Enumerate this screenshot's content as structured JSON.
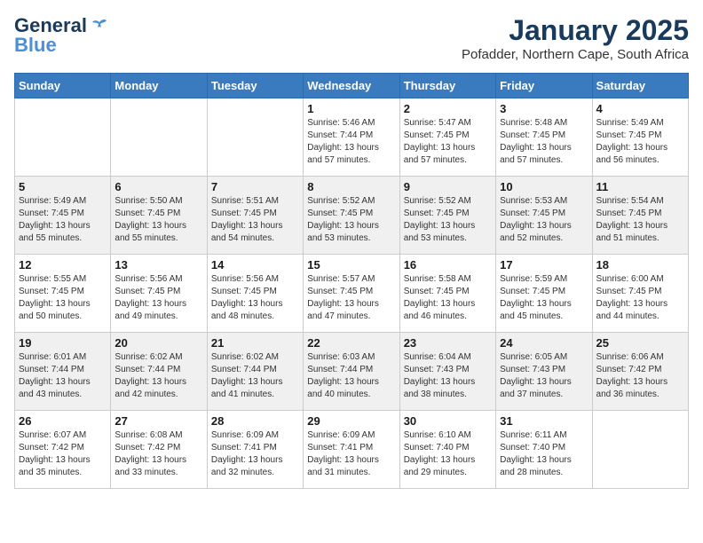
{
  "header": {
    "logo_line1": "General",
    "logo_line2": "Blue",
    "month": "January 2025",
    "location": "Pofadder, Northern Cape, South Africa"
  },
  "weekdays": [
    "Sunday",
    "Monday",
    "Tuesday",
    "Wednesday",
    "Thursday",
    "Friday",
    "Saturday"
  ],
  "weeks": [
    [
      {
        "day": "",
        "info": ""
      },
      {
        "day": "",
        "info": ""
      },
      {
        "day": "",
        "info": ""
      },
      {
        "day": "1",
        "info": "Sunrise: 5:46 AM\nSunset: 7:44 PM\nDaylight: 13 hours\nand 57 minutes."
      },
      {
        "day": "2",
        "info": "Sunrise: 5:47 AM\nSunset: 7:45 PM\nDaylight: 13 hours\nand 57 minutes."
      },
      {
        "day": "3",
        "info": "Sunrise: 5:48 AM\nSunset: 7:45 PM\nDaylight: 13 hours\nand 57 minutes."
      },
      {
        "day": "4",
        "info": "Sunrise: 5:49 AM\nSunset: 7:45 PM\nDaylight: 13 hours\nand 56 minutes."
      }
    ],
    [
      {
        "day": "5",
        "info": "Sunrise: 5:49 AM\nSunset: 7:45 PM\nDaylight: 13 hours\nand 55 minutes."
      },
      {
        "day": "6",
        "info": "Sunrise: 5:50 AM\nSunset: 7:45 PM\nDaylight: 13 hours\nand 55 minutes."
      },
      {
        "day": "7",
        "info": "Sunrise: 5:51 AM\nSunset: 7:45 PM\nDaylight: 13 hours\nand 54 minutes."
      },
      {
        "day": "8",
        "info": "Sunrise: 5:52 AM\nSunset: 7:45 PM\nDaylight: 13 hours\nand 53 minutes."
      },
      {
        "day": "9",
        "info": "Sunrise: 5:52 AM\nSunset: 7:45 PM\nDaylight: 13 hours\nand 53 minutes."
      },
      {
        "day": "10",
        "info": "Sunrise: 5:53 AM\nSunset: 7:45 PM\nDaylight: 13 hours\nand 52 minutes."
      },
      {
        "day": "11",
        "info": "Sunrise: 5:54 AM\nSunset: 7:45 PM\nDaylight: 13 hours\nand 51 minutes."
      }
    ],
    [
      {
        "day": "12",
        "info": "Sunrise: 5:55 AM\nSunset: 7:45 PM\nDaylight: 13 hours\nand 50 minutes."
      },
      {
        "day": "13",
        "info": "Sunrise: 5:56 AM\nSunset: 7:45 PM\nDaylight: 13 hours\nand 49 minutes."
      },
      {
        "day": "14",
        "info": "Sunrise: 5:56 AM\nSunset: 7:45 PM\nDaylight: 13 hours\nand 48 minutes."
      },
      {
        "day": "15",
        "info": "Sunrise: 5:57 AM\nSunset: 7:45 PM\nDaylight: 13 hours\nand 47 minutes."
      },
      {
        "day": "16",
        "info": "Sunrise: 5:58 AM\nSunset: 7:45 PM\nDaylight: 13 hours\nand 46 minutes."
      },
      {
        "day": "17",
        "info": "Sunrise: 5:59 AM\nSunset: 7:45 PM\nDaylight: 13 hours\nand 45 minutes."
      },
      {
        "day": "18",
        "info": "Sunrise: 6:00 AM\nSunset: 7:45 PM\nDaylight: 13 hours\nand 44 minutes."
      }
    ],
    [
      {
        "day": "19",
        "info": "Sunrise: 6:01 AM\nSunset: 7:44 PM\nDaylight: 13 hours\nand 43 minutes."
      },
      {
        "day": "20",
        "info": "Sunrise: 6:02 AM\nSunset: 7:44 PM\nDaylight: 13 hours\nand 42 minutes."
      },
      {
        "day": "21",
        "info": "Sunrise: 6:02 AM\nSunset: 7:44 PM\nDaylight: 13 hours\nand 41 minutes."
      },
      {
        "day": "22",
        "info": "Sunrise: 6:03 AM\nSunset: 7:44 PM\nDaylight: 13 hours\nand 40 minutes."
      },
      {
        "day": "23",
        "info": "Sunrise: 6:04 AM\nSunset: 7:43 PM\nDaylight: 13 hours\nand 38 minutes."
      },
      {
        "day": "24",
        "info": "Sunrise: 6:05 AM\nSunset: 7:43 PM\nDaylight: 13 hours\nand 37 minutes."
      },
      {
        "day": "25",
        "info": "Sunrise: 6:06 AM\nSunset: 7:42 PM\nDaylight: 13 hours\nand 36 minutes."
      }
    ],
    [
      {
        "day": "26",
        "info": "Sunrise: 6:07 AM\nSunset: 7:42 PM\nDaylight: 13 hours\nand 35 minutes."
      },
      {
        "day": "27",
        "info": "Sunrise: 6:08 AM\nSunset: 7:42 PM\nDaylight: 13 hours\nand 33 minutes."
      },
      {
        "day": "28",
        "info": "Sunrise: 6:09 AM\nSunset: 7:41 PM\nDaylight: 13 hours\nand 32 minutes."
      },
      {
        "day": "29",
        "info": "Sunrise: 6:09 AM\nSunset: 7:41 PM\nDaylight: 13 hours\nand 31 minutes."
      },
      {
        "day": "30",
        "info": "Sunrise: 6:10 AM\nSunset: 7:40 PM\nDaylight: 13 hours\nand 29 minutes."
      },
      {
        "day": "31",
        "info": "Sunrise: 6:11 AM\nSunset: 7:40 PM\nDaylight: 13 hours\nand 28 minutes."
      },
      {
        "day": "",
        "info": ""
      }
    ]
  ]
}
